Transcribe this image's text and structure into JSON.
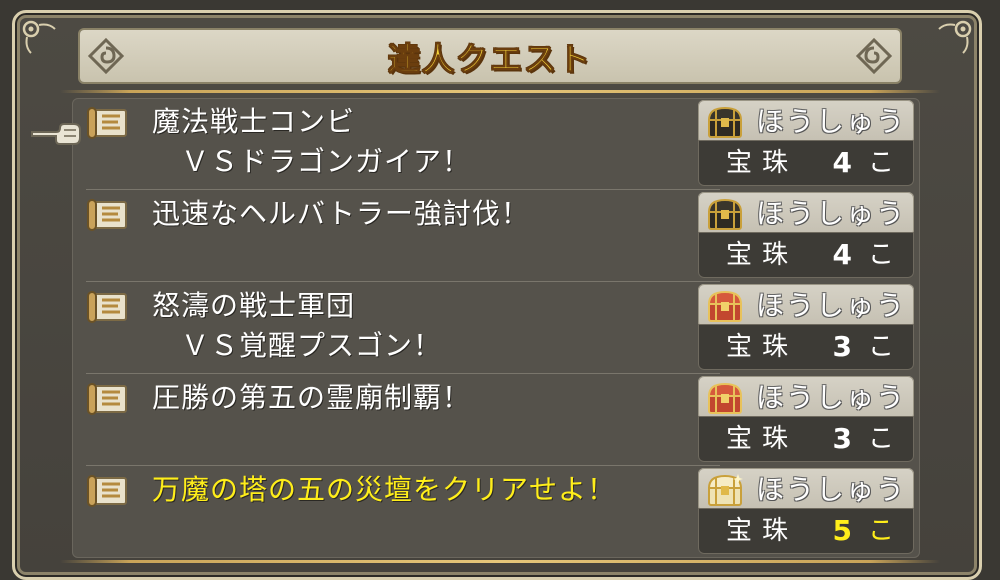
{
  "title": "達人クエスト",
  "reward_label": "ほうしゅう",
  "colors": {
    "title_gold": "#f4d33a",
    "highlight_yellow": "#ffee1a",
    "panel_dark": "#45423c"
  },
  "quests": [
    {
      "name": "魔法戦士コンビ\n　ＶＳドラゴンガイア！",
      "chest": "dark-chest-icon",
      "reward_item": "宝珠",
      "reward_qty": "4",
      "reward_unit": "こ",
      "highlight": false,
      "selected": true
    },
    {
      "name": "迅速なヘルバトラー強討伐！",
      "chest": "dark-chest-icon",
      "reward_item": "宝珠",
      "reward_qty": "4",
      "reward_unit": "こ",
      "highlight": false,
      "selected": false
    },
    {
      "name": "怒濤の戦士軍団\n　ＶＳ覚醒プスゴン！",
      "chest": "red-chest-icon",
      "reward_item": "宝珠",
      "reward_qty": "3",
      "reward_unit": "こ",
      "highlight": false,
      "selected": false
    },
    {
      "name": "圧勝の第五の霊廟制覇！",
      "chest": "red-chest-icon",
      "reward_item": "宝珠",
      "reward_qty": "3",
      "reward_unit": "こ",
      "highlight": false,
      "selected": false
    },
    {
      "name": "万魔の塔の五の災壇をクリアせよ！",
      "chest": "gold-chest-icon",
      "reward_item": "宝珠",
      "reward_qty": "5",
      "reward_unit": "こ",
      "highlight": true,
      "selected": false
    }
  ]
}
